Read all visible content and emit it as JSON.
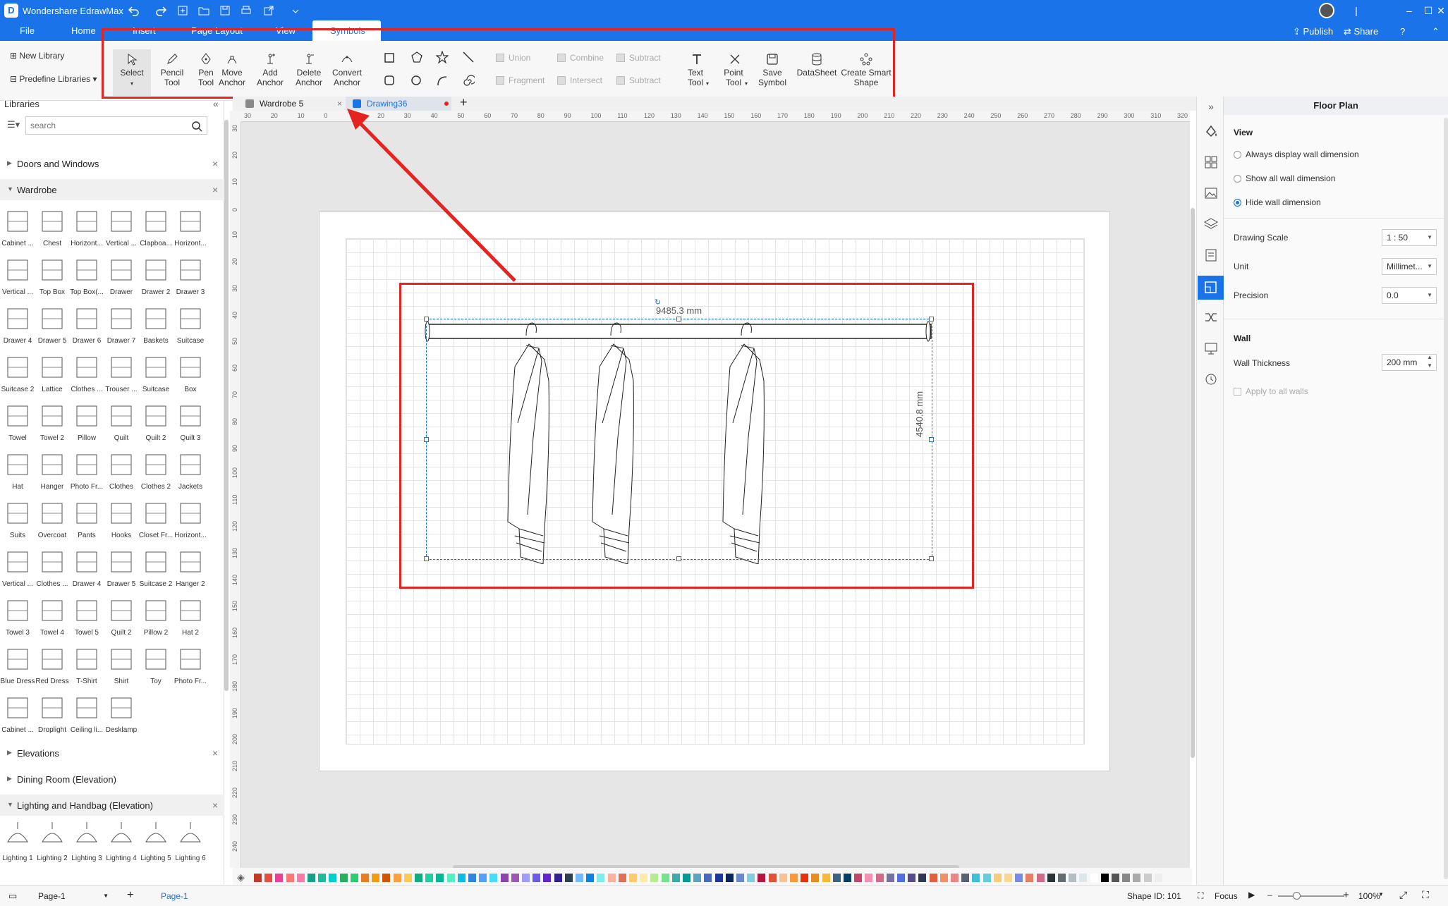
{
  "app": {
    "title": "Wondershare EdrawMax",
    "logo": "D"
  },
  "menu": {
    "items": [
      "File",
      "Home",
      "Insert",
      "Page Layout",
      "View",
      "Symbols"
    ],
    "active": "Symbols",
    "publish": "Publish",
    "share": "Share"
  },
  "ribbon": {
    "new_library": "New Library",
    "predefine_libraries": "Predefine Libraries",
    "tools": [
      {
        "label": "Select",
        "icon": "cursor-arrow-icon"
      },
      {
        "label": "Pencil Tool",
        "icon": "pencil-icon"
      },
      {
        "label": "Pen Tool",
        "icon": "pen-icon"
      },
      {
        "label": "Move Anchor",
        "icon": "move-anchor-icon"
      },
      {
        "label": "Add Anchor",
        "icon": "add-anchor-icon"
      },
      {
        "label": "Delete Anchor",
        "icon": "delete-anchor-icon"
      },
      {
        "label": "Convert Anchor",
        "icon": "convert-anchor-icon"
      }
    ],
    "bool_ops": [
      "Union",
      "Combine",
      "Subtract",
      "Fragment",
      "Intersect",
      "Subtract"
    ],
    "tools2": [
      {
        "label": "Text Tool",
        "icon": "text-tool-icon"
      },
      {
        "label": "Point Tool",
        "icon": "point-tool-icon"
      },
      {
        "label": "Save Symbol",
        "icon": "save-symbol-icon"
      },
      {
        "label": "DataSheet",
        "icon": "datasheet-icon"
      },
      {
        "label": "Create Smart Shape",
        "icon": "smart-shape-icon"
      }
    ]
  },
  "libraries": {
    "header": "Libraries",
    "search_placeholder": "search",
    "categories": {
      "doors": "Doors and Windows",
      "wardrobe": "Wardrobe",
      "elevations": "Elevations",
      "dining": "Dining Room (Elevation)",
      "lighting": "Lighting and Handbag (Elevation)"
    },
    "wardrobe_shapes": [
      "Cabinet ...",
      "Chest",
      "Horizont...",
      "Vertical ...",
      "Clapboa...",
      "Horizont...",
      "Vertical ...",
      "Top Box",
      "Top Box(...",
      "Drawer",
      "Drawer 2",
      "Drawer 3",
      "Drawer 4",
      "Drawer 5",
      "Drawer 6",
      "Drawer 7",
      "Baskets",
      "Suitcase",
      "Suitcase 2",
      "Lattice",
      "Clothes ...",
      "Trouser ...",
      "Suitcase",
      "Box",
      "Towel",
      "Towel 2",
      "Pillow",
      "Quilt",
      "Quilt 2",
      "Quilt 3",
      "Hat",
      "Hanger",
      "Photo Fr...",
      "Clothes",
      "Clothes 2",
      "Jackets",
      "Suits",
      "Overcoat",
      "Pants",
      "Hooks",
      "Closet Fr...",
      "Horizont...",
      "Vertical ...",
      "Clothes ...",
      "Drawer 4",
      "Drawer 5",
      "Suitcase 2",
      "Hanger 2",
      "Towel 3",
      "Towel 4",
      "Towel 5",
      "Quilt 2",
      "Pillow 2",
      "Hat 2",
      "Blue Dress",
      "Red Dress",
      "T-Shirt",
      "Shirt",
      "Toy",
      "Photo Fr...",
      "Cabinet ...",
      "Droplight",
      "Ceiling li...",
      "Desklamp"
    ],
    "lighting_shapes": [
      "Lighting 1",
      "Lighting 2",
      "Lighting 3",
      "Lighting 4",
      "Lighting 5",
      "Lighting 6"
    ]
  },
  "tabs": [
    {
      "label": "Wardrobe 5"
    },
    {
      "label": "Drawing36"
    }
  ],
  "ruler_h": [
    "30",
    "20",
    "10",
    "0",
    "10",
    "20",
    "30",
    "40",
    "50",
    "60",
    "70",
    "80",
    "90",
    "100",
    "110",
    "120",
    "130",
    "140",
    "150",
    "160",
    "170",
    "180",
    "190",
    "200",
    "210",
    "220",
    "230",
    "240",
    "250",
    "260",
    "270",
    "280",
    "290",
    "300",
    "310",
    "320"
  ],
  "ruler_v": [
    "30",
    "20",
    "10",
    "0",
    "10",
    "20",
    "30",
    "40",
    "50",
    "60",
    "70",
    "80",
    "90",
    "100",
    "110",
    "120",
    "130",
    "140",
    "150",
    "160",
    "170",
    "180",
    "190",
    "200",
    "210",
    "220",
    "230",
    "240"
  ],
  "drawing": {
    "width_dim": "9485.3 mm",
    "height_dim": "4540.8 mm"
  },
  "right_panel": {
    "title": "Floor Plan",
    "view_header": "View",
    "options": [
      "Always display wall dimension",
      "Show all wall dimension",
      "Hide wall dimension"
    ],
    "selected_option": "Hide wall dimension",
    "drawing_scale_label": "Drawing Scale",
    "drawing_scale": "1 : 50",
    "unit_label": "Unit",
    "unit": "Millimet...",
    "precision_label": "Precision",
    "precision": "0.0",
    "wall_header": "Wall",
    "wall_thickness_label": "Wall Thickness",
    "wall_thickness": "200 mm",
    "apply_all": "Apply to all walls"
  },
  "status": {
    "page_select": "Page-1",
    "page_tab": "Page-1",
    "shape_id": "Shape ID: 101",
    "focus": "Focus",
    "zoom": "100%"
  },
  "palette": [
    "#c0392b",
    "#e74c3c",
    "#e84393",
    "#ff7675",
    "#fd79a8",
    "#16a085",
    "#1abc9c",
    "#00cec9",
    "#27ae60",
    "#2ecc71",
    "#e67e22",
    "#f39c12",
    "#d35400",
    "#ff9f43",
    "#feca57",
    "#10ac84",
    "#1dd1a1",
    "#00b894",
    "#55efc4",
    "#0abde3",
    "#2e86de",
    "#54a0ff",
    "#48dbfb",
    "#8e44ad",
    "#9b59b6",
    "#a29bfe",
    "#6c5ce7",
    "#5f27cd",
    "#341f97",
    "#2c3e50",
    "#74b9ff",
    "#0984e3",
    "#81ecec",
    "#fab1a0",
    "#e17055",
    "#fdcb6e",
    "#ffeaa7",
    "#b8e994",
    "#78e08f",
    "#38ada9",
    "#079992",
    "#60a3bc",
    "#4a69bd",
    "#1e3799",
    "#0c2461",
    "#6a89cc",
    "#82ccdd",
    "#b71540",
    "#e55039",
    "#f8c291",
    "#fa983a",
    "#eb2f06",
    "#e58e26",
    "#f6b93b",
    "#3c6382",
    "#0a3d62",
    "#c44569",
    "#f78fb3",
    "#cf6a87",
    "#786fa6",
    "#546de5",
    "#574b90",
    "#303952",
    "#e15f41",
    "#f19066",
    "#ea8685",
    "#596275",
    "#3dc1d3",
    "#63cdda",
    "#f5cd79",
    "#f7d794",
    "#778beb",
    "#e77f67",
    "#cf6a87",
    "#2d3436",
    "#636e72",
    "#b2bec3",
    "#dfe6e9",
    "#ffffff",
    "#000000",
    "#555555",
    "#888888",
    "#aaaaaa",
    "#cccccc",
    "#eeeeee"
  ]
}
